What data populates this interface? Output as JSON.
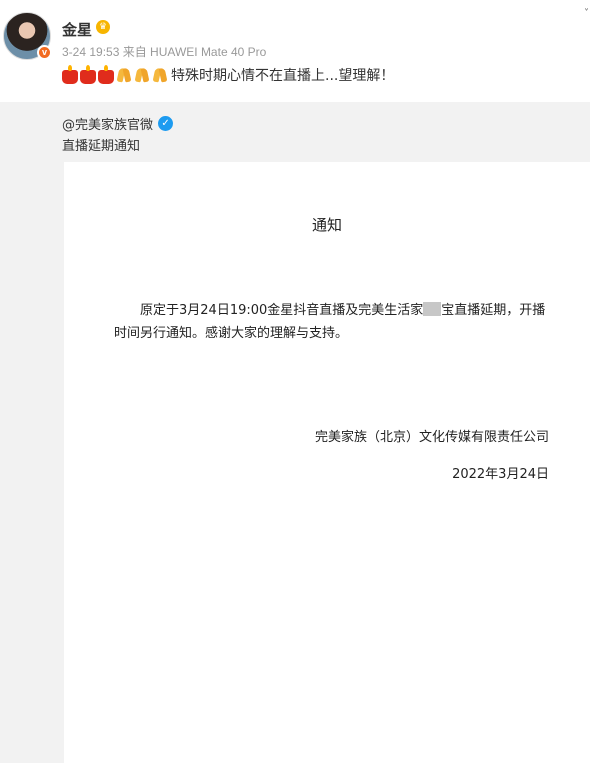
{
  "post": {
    "author": "金星",
    "meta": "3-24 19:53  来自 HUAWEI Mate 40 Pro",
    "avatar_badge": "v",
    "more_glyph": "˅",
    "text": "特殊时期心情不在直播上...望理解！",
    "emojis": [
      "candle-emoji",
      "candle-emoji",
      "candle-emoji",
      "pray-emoji",
      "pray-emoji",
      "pray-emoji"
    ]
  },
  "repost": {
    "author": "@完美家族官微",
    "verified_glyph": "✓",
    "text": "直播延期通知",
    "document": {
      "title": "通知",
      "body_part1": "原定于3月24日19:00金星抖音直播及完美生活家",
      "body_part2": "宝直播延期，开播时间另行通知。感谢大家的理解与支持。",
      "signer": "完美家族（北京）文化传媒有限责任公司",
      "date": "2022年3月24日"
    }
  },
  "colors": {
    "verified": "#1d9bf0",
    "avatar_badge": "#f26b21",
    "repost_background": "#f2f2f2",
    "meta_text": "#999999"
  }
}
